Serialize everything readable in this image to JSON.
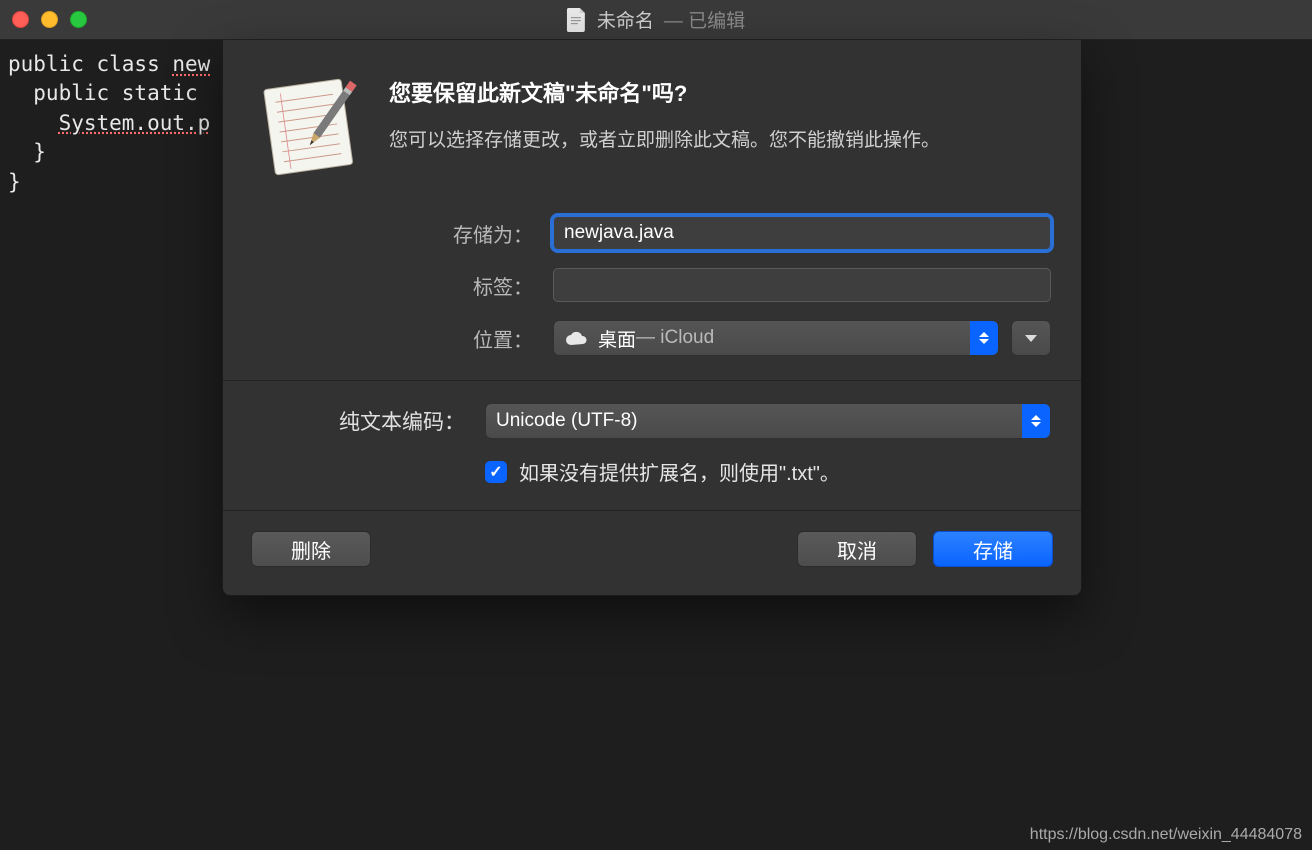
{
  "window": {
    "title_main": "未命名",
    "title_edited": "— 已编辑"
  },
  "editor": {
    "line1_pre": "public class ",
    "line1_err": "new",
    "line2": "  public static ",
    "line3_pre": "    ",
    "line3_err": "System.out.p",
    "line4": "  }",
    "line5": "}"
  },
  "dialog": {
    "title": "您要保留此新文稿\"未命名\"吗?",
    "subtitle": "您可以选择存储更改，或者立即删除此文稿。您不能撤销此操作。",
    "save_as_label": "存储为：",
    "filename": "newjava.java",
    "tags_label": "标签：",
    "tags_value": "",
    "location_label": "位置：",
    "location_value_main": "桌面",
    "location_value_sub": " — iCloud",
    "encoding_label": "纯文本编码：",
    "encoding_value": "Unicode (UTF-8)",
    "checkbox_label": "如果没有提供扩展名，则使用\".txt\"。",
    "delete_btn": "删除",
    "cancel_btn": "取消",
    "save_btn": "存储"
  },
  "watermark": "https://blog.csdn.net/weixin_44484078"
}
